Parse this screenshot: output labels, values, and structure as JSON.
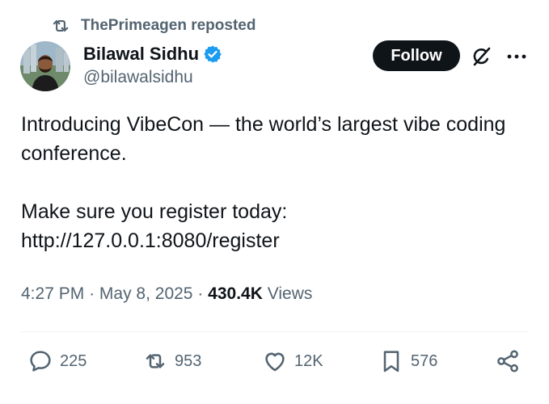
{
  "repost": {
    "text": "ThePrimeagen reposted"
  },
  "author": {
    "name": "Bilawal Sidhu",
    "handle": "@bilawalsidhu"
  },
  "header": {
    "follow_label": "Follow"
  },
  "tweet": {
    "line1": "Introducing VibeCon — the world’s largest vibe coding conference.",
    "line2": "Make sure you register today:",
    "line3": "http://127.0.0.1:8080/register"
  },
  "meta": {
    "time": "4:27 PM",
    "separator": "·",
    "date": "May 8, 2025",
    "views_count": "430.4K",
    "views_label": "Views"
  },
  "actions": {
    "replies": "225",
    "reposts": "953",
    "likes": "12K",
    "bookmarks": "576"
  },
  "icons": {
    "repost": "repost-icon",
    "verified": "verified-badge-icon",
    "grok": "grok-icon",
    "more": "more-icon",
    "reply": "reply-icon",
    "like": "heart-icon",
    "bookmark": "bookmark-icon",
    "share": "share-icon"
  },
  "colors": {
    "text_primary": "#0f1419",
    "text_secondary": "#536471",
    "verified_blue": "#1d9bf0",
    "follow_bg": "#0f1419",
    "divider": "#eff3f4"
  }
}
